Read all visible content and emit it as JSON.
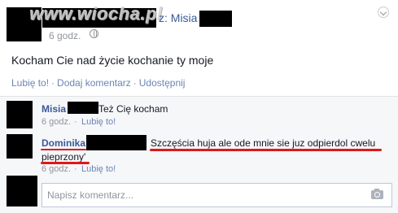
{
  "watermark": "www.wiocha.pl",
  "post": {
    "author_suffix": "z: Misia",
    "time": "6 godz.",
    "text": "Kocham Cie nad życie kochanie ty moje",
    "actions": [
      "Lubię to!",
      "Dodaj komentarz",
      "Udostępnij"
    ]
  },
  "comments": [
    {
      "name": "Misia",
      "text": "Też Cię kocham",
      "time": "6 godz.",
      "like": "Lubię to!"
    },
    {
      "name": "Dominika",
      "text_line1": "Szczęścia huja ale ode mnie sie juz odpierdol cwelu",
      "text_line2": "pieprzony'",
      "time": "6 godz.",
      "like": "Lubię to!"
    }
  ],
  "composer": {
    "placeholder": "Napisz komentarz..."
  },
  "colors": {
    "link": "#3b5998",
    "highlight": "#e01818",
    "comments_bg": "#f6f7f9"
  },
  "icons": [
    "globe-icon",
    "chevron-down-icon",
    "camera-icon"
  ]
}
